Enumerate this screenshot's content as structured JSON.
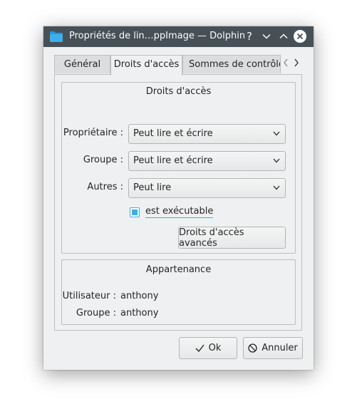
{
  "window": {
    "title": "Propriétés de lin…ppImage — Dolphin",
    "help_glyph": "?"
  },
  "tabs": [
    {
      "label": "Général"
    },
    {
      "label": "Droits d'accès",
      "active": true
    },
    {
      "label": "Sommes de contrôle"
    }
  ],
  "permissions": {
    "title": "Droits d'accès",
    "rows": [
      {
        "label": "Propriétaire :",
        "value": "Peut lire et écrire"
      },
      {
        "label": "Groupe :",
        "value": "Peut lire et écrire"
      },
      {
        "label": "Autres :",
        "value": "Peut lire"
      }
    ],
    "executable_label": "est exécutable",
    "executable_checked": true,
    "advanced_button": "Droits d'accès avancés"
  },
  "ownership": {
    "title": "Appartenance",
    "user_label": "Utilisateur :",
    "user_value": "anthony",
    "group_label": "Groupe :",
    "group_value": "anthony"
  },
  "buttons": {
    "ok": "Ok",
    "cancel": "Annuler"
  },
  "colors": {
    "titlebar": "#475057",
    "window_bg": "#eff0f1",
    "accent": "#3daee9"
  }
}
